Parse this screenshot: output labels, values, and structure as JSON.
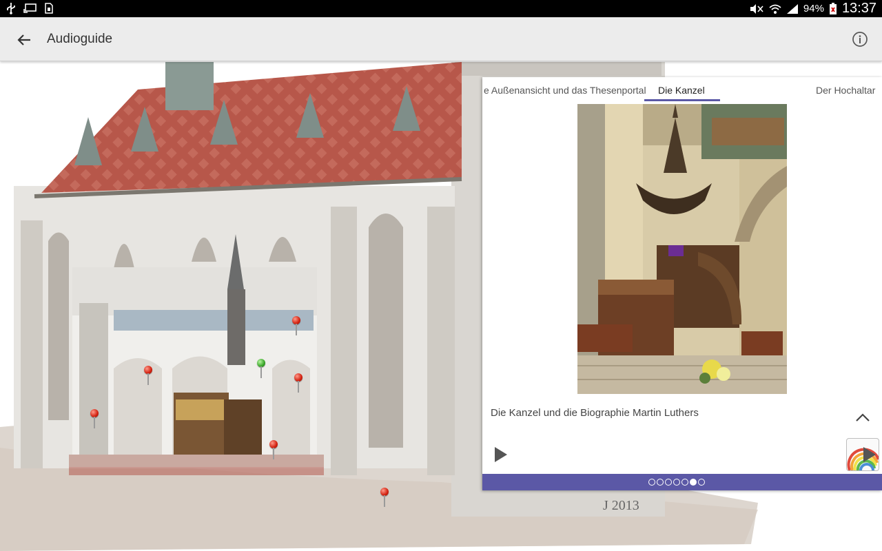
{
  "status_bar": {
    "left_icons": [
      "usb-icon",
      "cast-icon",
      "sim-icon"
    ],
    "right_icons": [
      "mute-icon",
      "wifi-icon",
      "signal-icon",
      "battery-icon"
    ],
    "battery": "94%",
    "time": "13:37"
  },
  "app_bar": {
    "title": "Audioguide",
    "back_icon": "arrow-back-icon",
    "info_icon": "info-icon"
  },
  "map": {
    "signature": "J 2013"
  },
  "panel": {
    "tabs": [
      {
        "label": "e Außenansicht und das Thesenportal",
        "active": false
      },
      {
        "label": "Die Kanzel",
        "active": true
      },
      {
        "label": "Der Hochaltar",
        "active": false
      }
    ],
    "caption": "Die Kanzel und die Biographie Martin Luthers",
    "pager": {
      "count": 7,
      "active_index": 5
    }
  },
  "colors": {
    "accent": "#5b58a6",
    "status_bar": "#000000",
    "app_bar": "#ececec"
  }
}
